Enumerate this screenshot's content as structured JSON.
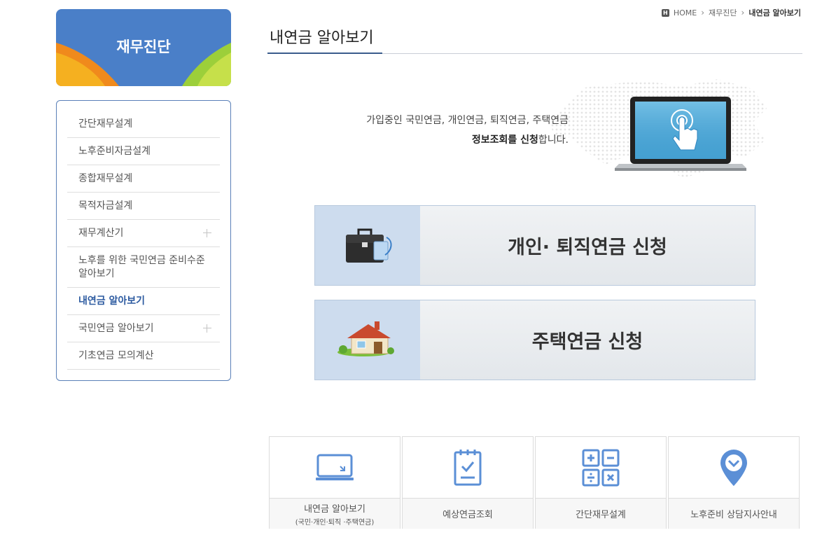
{
  "sidebar": {
    "banner_title": "재무진단",
    "items": [
      {
        "label": "간단재무설계"
      },
      {
        "label": "노후준비자금설계"
      },
      {
        "label": "종합재무설계"
      },
      {
        "label": "목적자금설계"
      },
      {
        "label": "재무계산기",
        "expandable": true
      },
      {
        "label": "노후를 위한 국민연금 준비수준 알아보기"
      },
      {
        "label": "내연금 알아보기",
        "active": true
      },
      {
        "label": "국민연금 알아보기",
        "expandable": true
      },
      {
        "label": "기초연금 모의계산"
      }
    ]
  },
  "breadcrumb": {
    "home": "HOME",
    "level1": "재무진단",
    "current": "내연금 알아보기"
  },
  "page_title": "내연금 알아보기",
  "intro": {
    "line1": "가입중인 국민연금, 개인연금, 퇴직연금, 주택연금",
    "line2_bold": "정보조회를 신청",
    "line2_rest": "합니다."
  },
  "actions": {
    "pension_label": "개인· 퇴직연금 신청",
    "housing_label": "주택연금 신청"
  },
  "quick_links": [
    {
      "label": "내연금 알아보기",
      "sub": "(국민·개인·퇴직 ·주택연금)",
      "icon": "monitor-icon"
    },
    {
      "label": "예상연금조회",
      "sub": "",
      "icon": "checklist-icon"
    },
    {
      "label": "간단재무설계",
      "sub": "",
      "icon": "calculator-icon"
    },
    {
      "label": "노후준비 상담지사안내",
      "sub": "",
      "icon": "location-pin-icon"
    }
  ],
  "colors": {
    "accent_blue": "#4a7fc8",
    "active_menu": "#2c5aa0",
    "icon_blue": "#5b8fd6"
  }
}
